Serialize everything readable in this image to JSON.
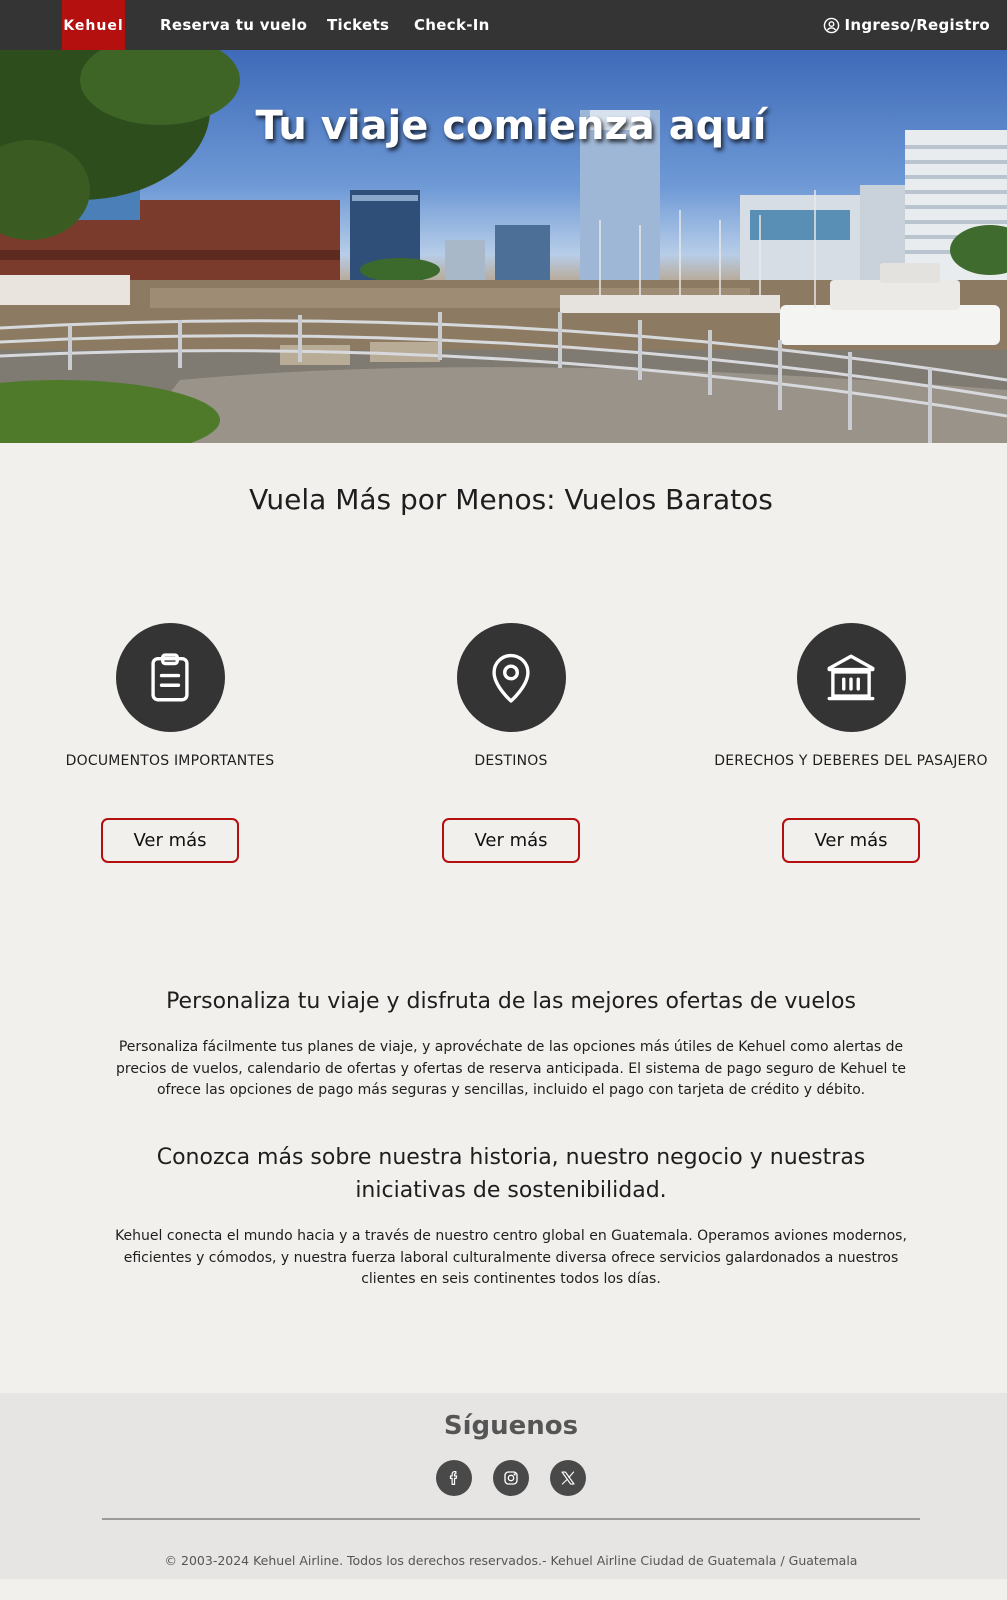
{
  "navbar": {
    "brand": "Kehuel",
    "links": [
      "Reserva tu vuelo",
      "Tickets",
      "Check-In"
    ],
    "login_label": "Ingreso/Registro",
    "login_icon": "user-circle-icon"
  },
  "hero": {
    "title": "Tu viaje comienza aquí"
  },
  "section": {
    "title": "Vuela Más por Menos: Vuelos Baratos"
  },
  "features": [
    {
      "label": "DOCUMENTOS IMPORTANTES",
      "icon": "clipboard-icon",
      "button": "Ver más"
    },
    {
      "label": "DESTINOS",
      "icon": "map-pin-icon",
      "button": "Ver más"
    },
    {
      "label": "DERECHOS Y DEBERES DEL PASAJERO",
      "icon": "bank-icon",
      "button": "Ver más"
    }
  ],
  "personaliza": {
    "title": "Personaliza tu viaje y disfruta de las mejores ofertas de vuelos",
    "text": "Personaliza fácilmente tus planes de viaje, y aprovéchate de las opciones más útiles de Kehuel como alertas de precios de vuelos, calendario de ofertas y ofertas de reserva anticipada. El sistema de pago seguro de Kehuel te ofrece las opciones de pago más seguras y sencillas, incluido el pago con tarjeta de crédito y débito."
  },
  "historia": {
    "title": "Conozca más sobre nuestra historia, nuestro negocio y nuestras iniciativas de sostenibilidad.",
    "text": "Kehuel conecta el mundo hacia y a través de nuestro centro global en Guatemala. Operamos aviones modernos, eficientes y cómodos, y nuestra fuerza laboral culturalmente diversa ofrece servicios galardonados a nuestros clientes en seis continentes todos los días."
  },
  "footer": {
    "follow": "Síguenos",
    "socials": [
      "facebook-icon",
      "instagram-icon",
      "x-icon"
    ],
    "copyright": "© 2003-2024 Kehuel Airline. Todos los derechos reservados.- Kehuel Airline Ciudad de Guatemala / Guatemala"
  },
  "colors": {
    "navbar": "#343434",
    "brand": "#b3100f",
    "background": "#f1f0ed",
    "button_border": "#b3100f",
    "footer": "#e6e5e3"
  }
}
